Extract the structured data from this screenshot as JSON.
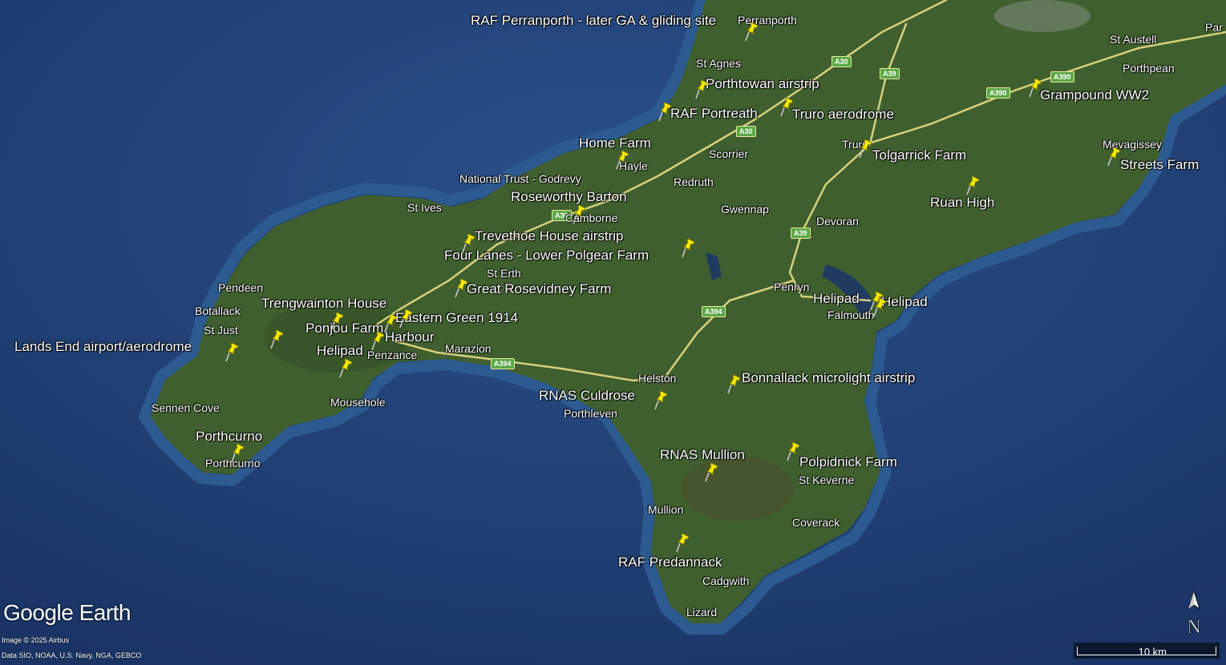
{
  "brand": "Google Earth",
  "credits": {
    "image": "Image © 2025 Airbus",
    "data": "Data SIO, NOAA, U.S. Navy, NGA, GEBCO"
  },
  "compass_letter": "N",
  "scale_label": "10 km",
  "colors": {
    "sea": "#1d3a6b",
    "land": "#3f5f2e",
    "pin": "#f6ea00",
    "road_badge": "#5aa845"
  },
  "towns": {
    "perranporth": "Perranporth",
    "st_agnes": "St Agnes",
    "st_austell": "St Austell",
    "par": "Par",
    "porthpean": "Porthpean",
    "mevagissey": "Mevagissey",
    "truro": "Truro",
    "scorrier": "Scorrier",
    "redruth": "Redruth",
    "gwennap": "Gwennap",
    "devoran": "Devoran",
    "hayle": "Hayle",
    "godrevy": "National Trust - Godrevy",
    "st_ives": "St Ives",
    "camborne": "Camborne",
    "st_erth": "St Erth",
    "pendeen": "Pendeen",
    "botallack": "Botallack",
    "st_just": "St Just",
    "penzance": "Penzance",
    "marazion": "Marazion",
    "mousehole": "Mousehole",
    "sennen_cove": "Sennen Cove",
    "porthcurno": "Porthcurno",
    "penryn": "Penryn",
    "falmouth": "Falmouth",
    "helston": "Helston",
    "porthleven": "Porthleven",
    "st_keverne": "St Keverne",
    "mullion": "Mullion",
    "coverack": "Coverack",
    "cadgwith": "Cadgwith",
    "lizard": "Lizard"
  },
  "roads": [
    "A30",
    "A39",
    "A390",
    "A390",
    "A30",
    "A30",
    "A39",
    "A394",
    "A394"
  ],
  "sites": {
    "perranporth": "RAF Perranporth - later GA & gliding site",
    "porthtowan": "Porthtowan airstrip",
    "portreath": "RAF Portreath",
    "truro_aero": "Truro aerodrome",
    "grampound": "Grampound WW2",
    "home_farm": "Home Farm",
    "tolgarrick": "Tolgarrick Farm",
    "streets": "Streets Farm",
    "roseworthy": "Roseworthy Barton",
    "ruan": "Ruan High",
    "trevethoe": "Trevethoe House airstrip",
    "four_lanes": "Four Lanes - Lower Polgear Farm",
    "rosevidney": "Great Rosevidney Farm",
    "trengwainton": "Trengwainton House",
    "helipad_falmouth_1": "Helipad",
    "helipad_falmouth_2": "Helipad",
    "eastern_green": "Eastern Green 1914",
    "ponjou": "Ponjou Farm",
    "harbour": "Harbour",
    "lands_end": "Lands End airport/aerodrome",
    "helipad_penzance": "Helipad",
    "bonnallack": "Bonnallack microlight airstrip",
    "culdrose": "RNAS Culdrose",
    "porthcurno": "Porthcurno",
    "mullion": "RNAS Mullion",
    "polpidnick": "Polpidnick Farm",
    "predannack": "RAF Predannack"
  },
  "pin_count": 30
}
